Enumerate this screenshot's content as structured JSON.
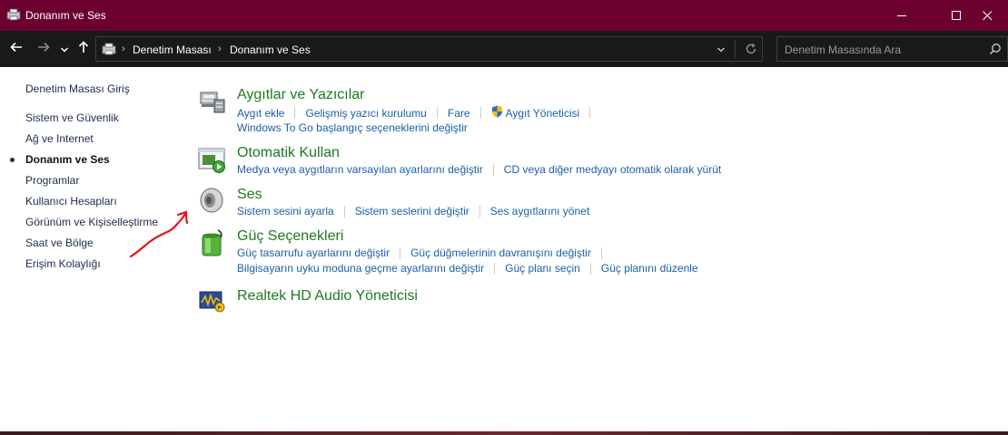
{
  "window": {
    "title": "Donanım ve Ses"
  },
  "address": {
    "crumbs": [
      "Denetim Masası",
      "Donanım ve Ses"
    ]
  },
  "search": {
    "placeholder": "Denetim Masasında Ara"
  },
  "sidebar": {
    "items": [
      {
        "label": "Denetim Masası Giriş"
      },
      {
        "label": "Sistem ve Güvenlik"
      },
      {
        "label": "Ağ ve Internet"
      },
      {
        "label": "Donanım ve Ses",
        "active": true
      },
      {
        "label": "Programlar"
      },
      {
        "label": "Kullanıcı Hesapları"
      },
      {
        "label": "Görünüm ve Kişiselleştirme"
      },
      {
        "label": "Saat ve Bölge"
      },
      {
        "label": "Erişim Kolaylığı"
      }
    ]
  },
  "sections": [
    {
      "title": "Aygıtlar ve Yazıcılar",
      "icon": "devices-printers-icon",
      "links": [
        [
          "Aygıt ekle",
          "Gelişmiş yazıcı kurulumu",
          "Fare",
          "Aygıt Yöneticisi"
        ],
        [
          "Windows To Go başlangıç seçeneklerini değiştir"
        ]
      ]
    },
    {
      "title": "Otomatik Kullan",
      "icon": "autoplay-icon",
      "links": [
        [
          "Medya veya aygıtların varsayılan ayarlarını değiştir",
          "CD veya diğer medyayı otomatik olarak yürüt"
        ]
      ]
    },
    {
      "title": "Ses",
      "icon": "speaker-icon",
      "links": [
        [
          "Sistem sesini ayarla",
          "Sistem seslerini değiştir",
          "Ses aygıtlarını yönet"
        ]
      ]
    },
    {
      "title": "Güç Seçenekleri",
      "icon": "battery-power-icon",
      "links": [
        [
          "Güç tasarrufu ayarlarını değiştir",
          "Güç düğmelerinin davranışını değiştir"
        ],
        [
          "Bilgisayarın uyku moduna geçme ayarlarını değiştir",
          "Güç planı seçin",
          "Güç planını düzenle"
        ]
      ]
    },
    {
      "title": "Realtek HD Audio Yöneticisi",
      "icon": "realtek-audio-icon",
      "links": []
    }
  ],
  "colors": {
    "titlebar": "#6b0030",
    "addressbar": "#191919",
    "section_title": "#1e7a1e",
    "link": "#1a5fa8",
    "annotation": "#e8101a"
  }
}
